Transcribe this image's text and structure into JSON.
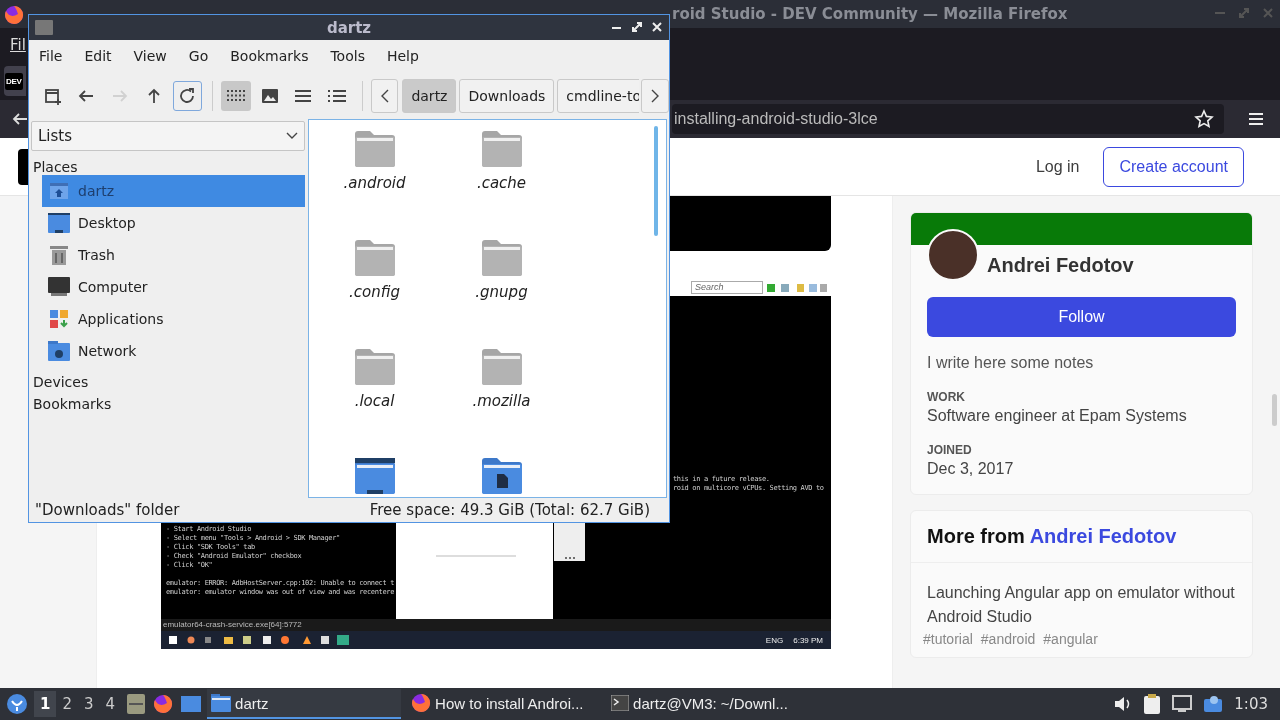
{
  "firefox": {
    "title": "roid Studio - DEV Community — Mozilla Firefox",
    "menu": [
      "Fil"
    ],
    "tab_favicon": "DEV",
    "url": "installing-android-studio-3lce"
  },
  "page": {
    "header": {
      "login": "Log in",
      "create_account": "Create account"
    },
    "screenshot": {
      "search_placeholder": "Search",
      "left_lines": [
        "- Start Android Studio",
        "- Select menu \"Tools > Android > SDK Manager\"",
        "- Click \"SDK Tools\" tab",
        "- Check \"Android Emulator\" checkbox",
        "- Click \"OK\""
      ],
      "error_lines": [
        "emulator: ERROR: AdbHostServer.cpp:102: Unable to connect t",
        "emulator: emulator window was out of view and was recentere"
      ],
      "right_lines": [
        "this in a future release.",
        "roid on multicore vCPUs. Setting AVD to"
      ],
      "status": "emulator64-crash-service.exe[64]:5772",
      "tray": [
        "ENG",
        "6:39 PM"
      ]
    },
    "profile": {
      "name": "Andrei Fedotov",
      "follow": "Follow",
      "bio": "I write here some notes",
      "fields": [
        {
          "label": "WORK",
          "value": "Software engineer at Epam Systems"
        },
        {
          "label": "JOINED",
          "value": "Dec 3, 2017"
        }
      ]
    },
    "more_from": {
      "heading": "More from",
      "author": "Andrei Fedotov",
      "articles": [
        {
          "title": "Launching Angular app on emulator without Android Studio",
          "tags": [
            "#tutorial",
            "#android",
            "#angular"
          ]
        }
      ]
    }
  },
  "file_manager": {
    "title": "dartz",
    "menu": [
      "File",
      "Edit",
      "View",
      "Go",
      "Bookmarks",
      "Tools",
      "Help"
    ],
    "nav_buttons": [
      {
        "kind": "new-tab",
        "disabled": false,
        "focused": false
      },
      {
        "kind": "back",
        "disabled": false,
        "focused": false
      },
      {
        "kind": "forward",
        "disabled": true,
        "focused": false
      },
      {
        "kind": "up",
        "disabled": false,
        "focused": false
      },
      {
        "kind": "reload",
        "disabled": false,
        "focused": true
      }
    ],
    "view_buttons": [
      {
        "kind": "icon-view",
        "selected": true
      },
      {
        "kind": "thumbnail-view",
        "selected": false
      },
      {
        "kind": "compact-view",
        "selected": false
      },
      {
        "kind": "detailed-view",
        "selected": false
      }
    ],
    "path": [
      {
        "label": "dartz",
        "selected": true
      },
      {
        "label": "Downloads",
        "selected": false
      },
      {
        "label": "cmdline-to",
        "selected": false
      }
    ],
    "side_pane_mode": "Lists",
    "places_title": "Places",
    "places": [
      {
        "label": "dartz",
        "kind": "home",
        "selected": true
      },
      {
        "label": "Desktop",
        "kind": "desktop",
        "selected": false
      },
      {
        "label": "Trash",
        "kind": "trash",
        "selected": false
      },
      {
        "label": "Computer",
        "kind": "computer",
        "selected": false
      },
      {
        "label": "Applications",
        "kind": "applications",
        "selected": false
      },
      {
        "label": "Network",
        "kind": "network",
        "selected": false
      }
    ],
    "other_sections": [
      "Devices",
      "Bookmarks"
    ],
    "files": [
      {
        "name": ".android",
        "kind": "folder"
      },
      {
        "name": ".cache",
        "kind": "folder"
      },
      {
        "name": ".config",
        "kind": "folder"
      },
      {
        "name": ".gnupg",
        "kind": "folder"
      },
      {
        "name": ".local",
        "kind": "folder"
      },
      {
        "name": ".mozilla",
        "kind": "folder"
      },
      {
        "kind": "desktop-folder"
      },
      {
        "kind": "documents-folder"
      }
    ],
    "status_left": "\"Downloads\" folder",
    "status_right": "Free space: 49.3 GiB (Total: 62.7 GiB)"
  },
  "taskbar": {
    "workspaces": [
      {
        "label": "1",
        "selected": true
      },
      {
        "label": "2",
        "selected": false
      },
      {
        "label": "3",
        "selected": false
      },
      {
        "label": "4",
        "selected": false
      }
    ],
    "tasks": [
      {
        "label": "dartz",
        "kind": "folder",
        "selected": true
      },
      {
        "label": "How to install Androi...",
        "kind": "browser",
        "selected": false
      },
      {
        "label": "dartz@VM3: ~/Downl...",
        "kind": "terminal",
        "selected": false
      }
    ],
    "clock": "1:03"
  }
}
